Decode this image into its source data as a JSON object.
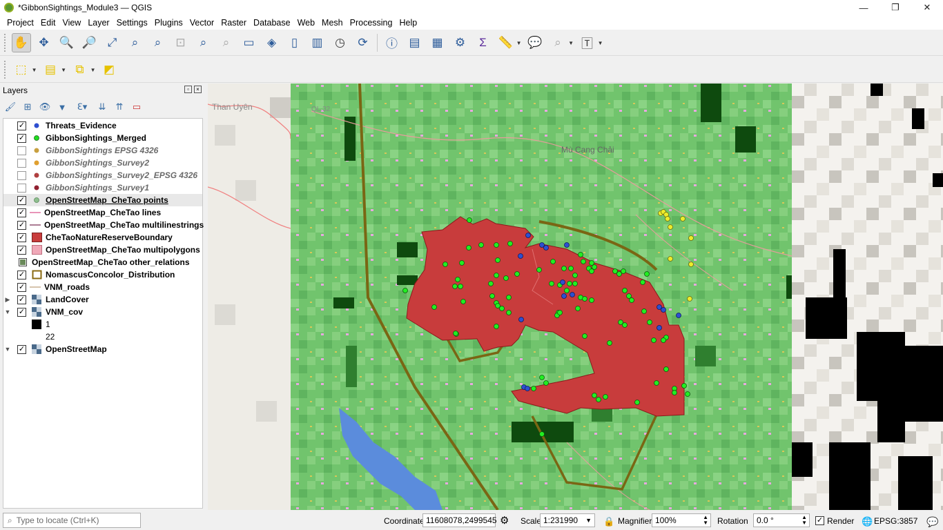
{
  "window": {
    "title": "*GibbonSightings_Module3 — QGIS",
    "buttons": [
      "—",
      "❐",
      "✕"
    ]
  },
  "menu": [
    "Project",
    "Edit",
    "View",
    "Layer",
    "Settings",
    "Plugins",
    "Vector",
    "Raster",
    "Database",
    "Web",
    "Mesh",
    "Processing",
    "Help"
  ],
  "toolbar_icons": [
    "pan-map",
    "pan-to-selection",
    "zoom-in",
    "zoom-out",
    "zoom-full",
    "zoom-to-selection",
    "zoom-to-layer",
    "zoom-native",
    "zoom-last",
    "zoom-next",
    "new-map-view",
    "new-3d-map-view",
    "new-bookmark",
    "show-bookmarks",
    "temporal-controller",
    "refresh",
    "identify",
    "attribute-table",
    "field-calculator",
    "processing-toolbox",
    "statistical-summary",
    "measure",
    "map-tips",
    "text-annotation"
  ],
  "layers_panel": {
    "title": "Layers",
    "legend_values": [
      "1",
      "22"
    ],
    "layers": [
      {
        "name": "Threats_Evidence",
        "checked": true,
        "color": "#2e4fd0",
        "style": "bold"
      },
      {
        "name": "GibbonSightings_Merged",
        "checked": true,
        "color": "#22dd22",
        "style": "bold"
      },
      {
        "name": "GibbonSightings EPSG 4326",
        "checked": false,
        "color": "#c8a040",
        "style": "italic"
      },
      {
        "name": "GibbonSightings_Survey2",
        "checked": false,
        "color": "#e0a030",
        "style": "italic"
      },
      {
        "name": "GibbonSightings_Survey2_EPSG 4326",
        "checked": false,
        "color": "#b04040",
        "style": "italic"
      },
      {
        "name": "GibbonSightings_Survey1",
        "checked": false,
        "color": "#902030",
        "style": "italic"
      },
      {
        "name": "OpenStreetMap_CheTao points",
        "checked": true,
        "color": "#8fbf8f",
        "style": "bold-underline"
      },
      {
        "name": "OpenStreetMap_CheTao lines",
        "checked": true,
        "color": "#e070a0",
        "style": "bold"
      },
      {
        "name": "OpenStreetMap_CheTao multilinestrings",
        "checked": true,
        "color": "#905070",
        "style": "bold"
      },
      {
        "name": "CheTaoNatureReserveBoundary",
        "checked": true,
        "color": "#c83c3c",
        "style": "bold"
      },
      {
        "name": "OpenStreetMap_CheTao multipolygons",
        "checked": true,
        "color": "#f0a8b8",
        "style": "bold"
      },
      {
        "name": "OpenStreetMap_CheTao other_relations",
        "checked": null,
        "color": "#888888",
        "style": "bold"
      },
      {
        "name": "NomascusConcolor_Distribution",
        "checked": true,
        "color": "#8a6a10",
        "style": "bold"
      },
      {
        "name": "VNM_roads",
        "checked": true,
        "color": "#c8b090",
        "style": "bold"
      },
      {
        "name": "LandCover",
        "checked": true,
        "color": "#4a6a8a",
        "style": "bold"
      },
      {
        "name": "VNM_cov",
        "checked": true,
        "color": "#4a6a8a",
        "style": "bold"
      },
      {
        "name": "OpenStreetMap",
        "checked": true,
        "color": "#4a6a8a",
        "style": "bold"
      }
    ]
  },
  "map_labels": {
    "town1": "Than Uyên",
    "town2": "Mù Cang Chải",
    "road": "QL.32"
  },
  "status": {
    "locate_placeholder": "Type to locate (Ctrl+K)",
    "coordinate_label": "Coordinate",
    "coordinate_value": "11608078,2499545",
    "scale_label": "Scale",
    "scale_value": "1:231990",
    "magnifier_label": "Magnifier",
    "magnifier_value": "100%",
    "rotation_label": "Rotation",
    "rotation_value": "0.0 °",
    "render_label": "Render",
    "crs": "EPSG:3857"
  }
}
